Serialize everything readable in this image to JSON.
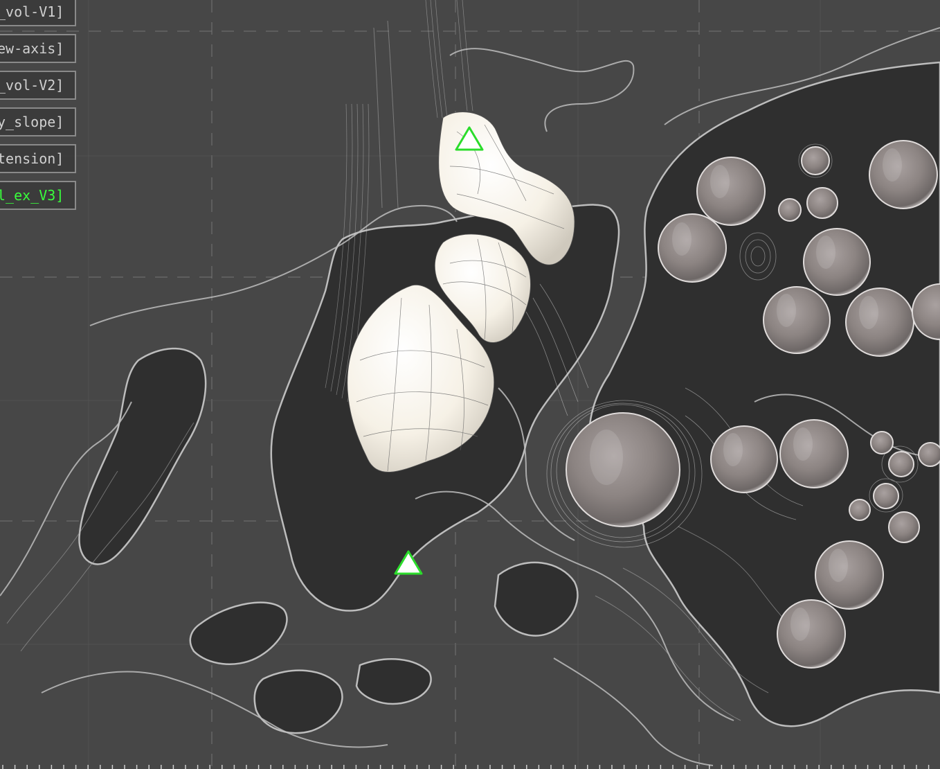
{
  "layers": [
    {
      "label": "_vol-V1]",
      "active": false
    },
    {
      "label": "ew-axis]",
      "active": false
    },
    {
      "label": "_vol-V2]",
      "active": false
    },
    {
      "label": "y_slope]",
      "active": false
    },
    {
      "label": "tension]",
      "active": false
    },
    {
      "label": "l_ex_V3]",
      "active": true
    }
  ],
  "markers": [
    {
      "name": "viewpoint-marker-1"
    },
    {
      "name": "viewpoint-marker-2"
    }
  ],
  "colors": {
    "background": "#474747",
    "terrain_dark": "#2f2f2f",
    "contour": "#bdbdbd",
    "active_text": "#39ff3c",
    "marker": "#2bdc2b"
  }
}
